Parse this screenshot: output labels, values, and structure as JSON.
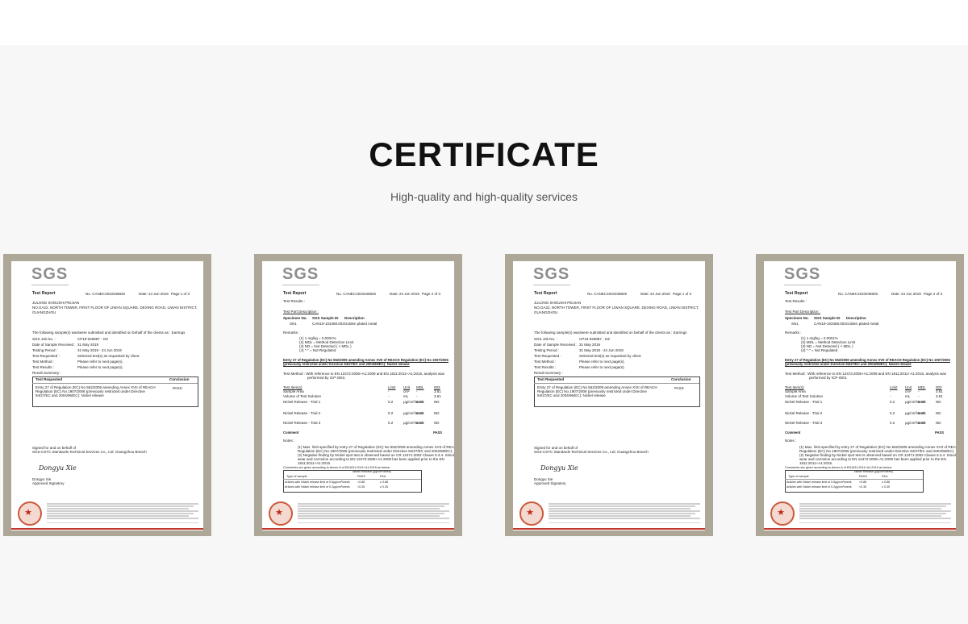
{
  "header": {
    "title": "CERTIFICATE",
    "subtitle": "High-quality and high-quality services"
  },
  "certificates": [
    {
      "logo": "SGS",
      "doc_title": "Test Report",
      "ref": "No. CANEC1910346825",
      "date": "Date: 24 Jun 2019",
      "page": "Page 1 of 3",
      "company": "JULONG SHOUSHI PEIJIAN",
      "address": "NO.GA22, NORTH TOWER, FIRST FLOOR OF LIWAN SQUARE, DEXING ROAD, LIWAN DISTRICT,",
      "city": "GUANGZHOU",
      "intro": "The following sample(s) was/were submitted and identified on behalf of the clients as : Earrings",
      "job_label": "SGS Job No. :",
      "job_value": "CP19-026887 - GZ",
      "received_label": "Date of Sample Received :",
      "received_value": "31 May 2019",
      "period_label": "Testing Period :",
      "period_value": "31 May 2019 - 24 Jun 2019",
      "requested_label": "Test Requested :",
      "requested_value": "Selected test(s) as requested by client.",
      "method_label": "Test Method :",
      "method_value": "Please refer to next page(s).",
      "results_label": "Test Results :",
      "results_value": "Please refer to next page(s).",
      "summary_label": "Result Summary :",
      "table_head": "Test Requested",
      "table_conc_head": "Conclusion",
      "table_row": "Entry 27 of Regulation (EC) No 552/2009 amending Annex XVII of REACH Regulation (EC) No 1907/2006 (previously restricted under Directive 94/27/EC and 2004/96/EC): Nickel release",
      "table_conc": "PASS",
      "signed": "Signed for and on behalf of",
      "signed_org": "SGS-CSTC Standards Technical Services Co., Ltd. Guangzhou Branch",
      "signature": "Dongyu Xie",
      "signer": "Dongyu Xie",
      "signer_role": "Approved Signatory",
      "variant": "summary"
    },
    {
      "logo": "SGS",
      "doc_title": "Test Report",
      "ref": "No. CANEC1910346825",
      "date": "Date: 24 Jun 2019",
      "page": "Page 2 of 3",
      "results_head": "Test Results :",
      "part_desc": "Test Part Description :",
      "spec_no": "Specimen No.",
      "spec_id": "SGS Sample ID",
      "spec_desc": "Description",
      "spec_row_no": "SN1",
      "spec_row_id": "CAN19-103468.003",
      "spec_row_desc": "Golden plated metal",
      "remarks": "Remarks :",
      "remark1": "(1) 1 mg/kg = 0.0001%",
      "remark2": "(2) MDL = Method Detection Limit",
      "remark3": "(3) ND = Not Detected ( < MDL )",
      "remark4": "(4) \"-\" = Not Regulated",
      "entry_bold": "Entry 27 of Regulation (EC) No 552/2009 amending Annex XVII of REACH Regulation (EC) No 1907/2006",
      "entry_bold2": "(previously restricted under Directive 94/27/EC and 2004/96/EC): Nickel release",
      "method": "Test Method :  With reference to EN 12472:2005+A1:2009 and EN 1811:2011+A1:2015, analysis was",
      "method2": "performed by ICP-OES.",
      "cols": [
        "Test Item(s)",
        "Limit",
        "Unit",
        "MDL",
        "003"
      ],
      "rows": [
        [
          "Sample Area",
          "-",
          "cm²",
          "-",
          "3.61"
        ],
        [
          "Volume of Test Solution",
          "-",
          "mL",
          "-",
          "3.61"
        ],
        [
          "Nickel Release - Trial 1",
          "0.2",
          "μg/cm²/week",
          "0.10",
          "ND"
        ],
        [
          "Nickel Release - Trial 2",
          "0.2",
          "μg/cm²/week",
          "0.10",
          "ND"
        ],
        [
          "Nickel Release - Trial 3",
          "0.2",
          "μg/cm²/week",
          "0.10",
          "ND"
        ]
      ],
      "comment": "Comment",
      "comment_value": "PASS",
      "notes": "Notes :",
      "note1": "(1) Max. limit specified by entry 27 of Regulation (EC) No 552/2009 amending Annex XVII of REACH",
      "note1b": "Regulation (EC) No 1907/2006 (previously restricted under Directive 94/27/EC and 2004/96/EC).",
      "note2": "(2) Negative finding by Nickel spot test is observed based on CR 12471:2002 Clause 5.3.4. Simulation of",
      "note2b": "wear and corrosion according to EN 12472:2005+A1:2009 has been applied prior to the EN",
      "note2c": "1811:2011+A1:2015.",
      "note3": "Comments are given according to Annex A of EN1811:2011+A1:2015 as below:",
      "small_table_head": "Nickel Release (μg/cm²/week)",
      "small_table_col1": "Type of sample",
      "small_table_pass": "PASS",
      "small_table_fail": "FAIL",
      "small_row1": "Articles with Nickel release limit of 0.5μg/cm²/week",
      "small_row1_pass": "<0.88",
      "small_row1_fail": "≥ 0.88",
      "small_row2": "Articles with Nickel release limit of 0.2μg/cm²/week",
      "small_row2_pass": "<0.35",
      "small_row2_fail": "≥ 0.35",
      "variant": "results"
    },
    {
      "logo": "SGS",
      "doc_title": "Test Report",
      "ref": "No. CANEC1910346825",
      "date": "Date: 24 Jun 2019",
      "page": "Page 1 of 3",
      "company": "JULONG SHOUSHI PEIJIAN",
      "address": "NO.GA22, NORTH TOWER, FIRST FLOOR OF LIWAN SQUARE, DEXING ROAD, LIWAN DISTRICT,",
      "city": "GUANGZHOU",
      "intro": "The following sample(s) was/were submitted and identified on behalf of the clients as : Earrings",
      "job_label": "SGS Job No. :",
      "job_value": "CP19-026887 - GZ",
      "received_label": "Date of Sample Received :",
      "received_value": "31 May 2019",
      "period_label": "Testing Period :",
      "period_value": "31 May 2019 - 24 Jun 2019",
      "requested_label": "Test Requested :",
      "requested_value": "Selected test(s) as requested by client.",
      "method_label": "Test Method :",
      "method_value": "Please refer to next page(s).",
      "results_label": "Test Results :",
      "results_value": "Please refer to next page(s).",
      "summary_label": "Result Summary :",
      "table_head": "Test Requested",
      "table_conc_head": "Conclusion",
      "table_row": "Entry 27 of Regulation (EC) No 552/2009 amending Annex XVII of REACH Regulation (EC) No 1907/2006 (previously restricted under Directive 94/27/EC and 2004/96/EC): Nickel release",
      "table_conc": "PASS",
      "signed": "Signed for and on behalf of",
      "signed_org": "SGS-CSTC Standards Technical Services Co., Ltd. Guangzhou Branch",
      "signature": "Dongyu Xie",
      "signer": "Dongyu Xie",
      "signer_role": "Approved Signatory",
      "variant": "summary"
    },
    {
      "logo": "SGS",
      "doc_title": "Test Report",
      "ref": "No. CANEC1910346825",
      "date": "Date: 24 Jun 2019",
      "page": "Page 2 of 3",
      "results_head": "Test Results :",
      "part_desc": "Test Part Description :",
      "spec_no": "Specimen No.",
      "spec_id": "SGS Sample ID",
      "spec_desc": "Description",
      "spec_row_no": "SN1",
      "spec_row_id": "CAN19-103468.003",
      "spec_row_desc": "Golden plated metal",
      "remarks": "Remarks :",
      "remark1": "(1) 1 mg/kg = 0.0001%",
      "remark2": "(2) MDL = Method Detection Limit",
      "remark3": "(3) ND = Not Detected ( < MDL )",
      "remark4": "(4) \"-\" = Not Regulated",
      "entry_bold": "Entry 27 of Regulation (EC) No 552/2009 amending Annex XVII of REACH Regulation (EC) No 1907/2006",
      "entry_bold2": "(previously restricted under Directive 94/27/EC and 2004/96/EC): Nickel release",
      "method": "Test Method :  With reference to EN 12472:2005+A1:2009 and EN 1811:2011+A1:2015, analysis was",
      "method2": "performed by ICP-OES.",
      "cols": [
        "Test Item(s)",
        "Limit",
        "Unit",
        "MDL",
        "003"
      ],
      "rows": [
        [
          "Sample Area",
          "-",
          "cm²",
          "-",
          "3.61"
        ],
        [
          "Volume of Test Solution",
          "-",
          "mL",
          "-",
          "3.61"
        ],
        [
          "Nickel Release - Trial 1",
          "0.2",
          "μg/cm²/week",
          "0.10",
          "ND"
        ],
        [
          "Nickel Release - Trial 2",
          "0.2",
          "μg/cm²/week",
          "0.10",
          "ND"
        ],
        [
          "Nickel Release - Trial 3",
          "0.2",
          "μg/cm²/week",
          "0.10",
          "ND"
        ]
      ],
      "comment": "Comment",
      "comment_value": "PASS",
      "notes": "Notes :",
      "note1": "(1) Max. limit specified by entry 27 of Regulation (EC) No 552/2009 amending Annex XVII of REACH",
      "note1b": "Regulation (EC) No 1907/2006 (previously restricted under Directive 94/27/EC and 2004/96/EC).",
      "note2": "(2) Negative finding by Nickel spot test is observed based on CR 12471:2002 Clause 5.3.4. Simulation of",
      "note2b": "wear and corrosion according to EN 12472:2005+A1:2009 has been applied prior to the EN",
      "note2c": "1811:2011+A1:2015.",
      "note3": "Comments are given according to Annex A of EN1811:2011+A1:2015 as below:",
      "small_table_head": "Nickel Release (μg/cm²/week)",
      "small_table_col1": "Type of sample",
      "small_table_pass": "PASS",
      "small_table_fail": "FAIL",
      "small_row1": "Articles with Nickel release limit of 0.5μg/cm²/week",
      "small_row1_pass": "<0.88",
      "small_row1_fail": "≥ 0.88",
      "small_row2": "Articles with Nickel release limit of 0.2μg/cm²/week",
      "small_row2_pass": "<0.35",
      "small_row2_fail": "≥ 0.35",
      "variant": "results"
    }
  ]
}
